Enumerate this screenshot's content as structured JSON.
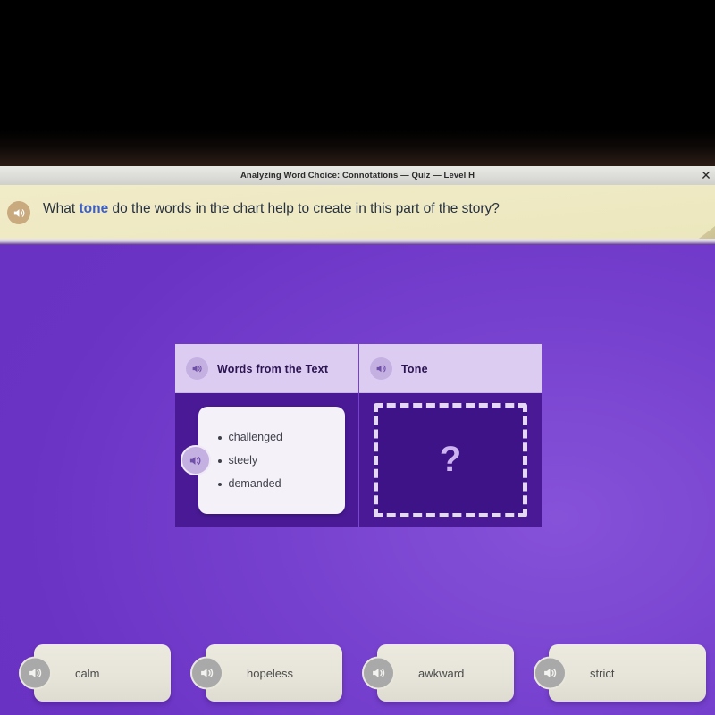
{
  "window": {
    "title": "Analyzing Word Choice: Connotations — Quiz — Level H",
    "close_label": "✕"
  },
  "question": {
    "prefix": "What ",
    "highlight": "tone",
    "suffix": " do the words in the chart help to create in this part of the story?",
    "full_text": "What tone do the words in the chart help to create in this part of the story?",
    "speaker_icon": "speaker-icon",
    "highlight_color": "#3d5fc4",
    "banner_color": "#efeac4"
  },
  "chart": {
    "columns": [
      {
        "header": "Words from the Text",
        "speaker_icon": "speaker-icon"
      },
      {
        "header": "Tone",
        "speaker_icon": "speaker-icon"
      }
    ],
    "words": [
      "challenged",
      "steely",
      "demanded"
    ],
    "words_speaker_icon": "speaker-icon",
    "dropzone_placeholder": "?",
    "header_bg": "#ddccf2",
    "body_bg": "#4a1a96",
    "dropzone_bg": "#3f1388"
  },
  "options": [
    {
      "label": "calm",
      "speaker_icon": "speaker-icon"
    },
    {
      "label": "hopeless",
      "speaker_icon": "speaker-icon"
    },
    {
      "label": "awkward",
      "speaker_icon": "speaker-icon"
    },
    {
      "label": "strict",
      "speaker_icon": "speaker-icon"
    }
  ],
  "theme": {
    "stage_purple": "#7038c8",
    "stage_purple_light": "#8652d8"
  }
}
